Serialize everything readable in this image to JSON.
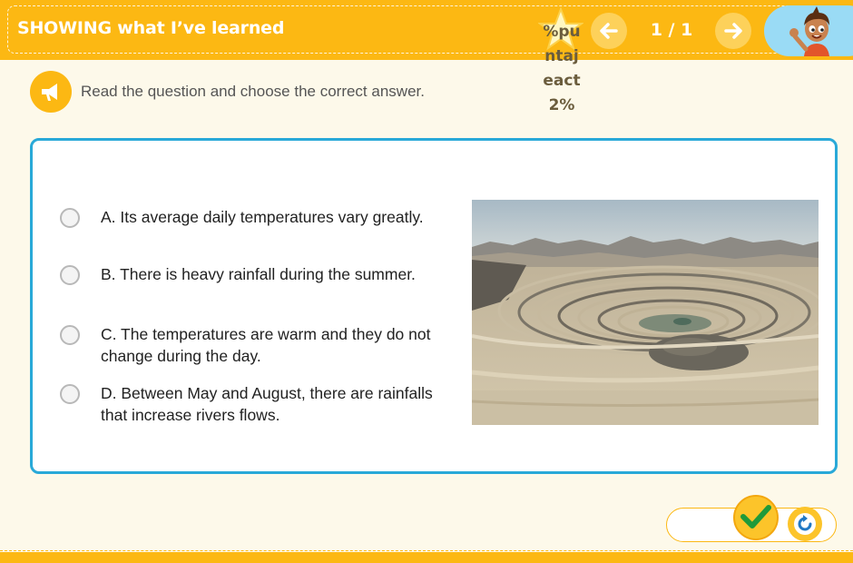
{
  "header": {
    "title": "SHOWING what I’ve learned",
    "score_text": "%puntajeact2%",
    "page_indicator": "1 / 1",
    "prev_icon": "arrow-left-icon",
    "next_icon": "arrow-right-icon",
    "avatar_icon": "boy-mascot-avatar"
  },
  "instruction": {
    "icon": "megaphone-icon",
    "text": "Read the question and choose the correct answer."
  },
  "question": {
    "options": [
      {
        "label": "A. Its average daily temperatures vary greatly."
      },
      {
        "label": "B. There is heavy rainfall during the summer."
      },
      {
        "label": "C. The temperatures are warm and they do not change during the day."
      },
      {
        "label": "D. Between May and August, there are rainfalls that increase rivers flows."
      }
    ],
    "image": "open-pit-mine-desert-photo"
  },
  "footer": {
    "check_icon": "checkmark-icon",
    "reset_icon": "reset-icon"
  },
  "colors": {
    "accent": "#fcb813",
    "card_border": "#29a9d8",
    "background": "#fdf9ea",
    "avatar_bg": "#9adbf5"
  }
}
